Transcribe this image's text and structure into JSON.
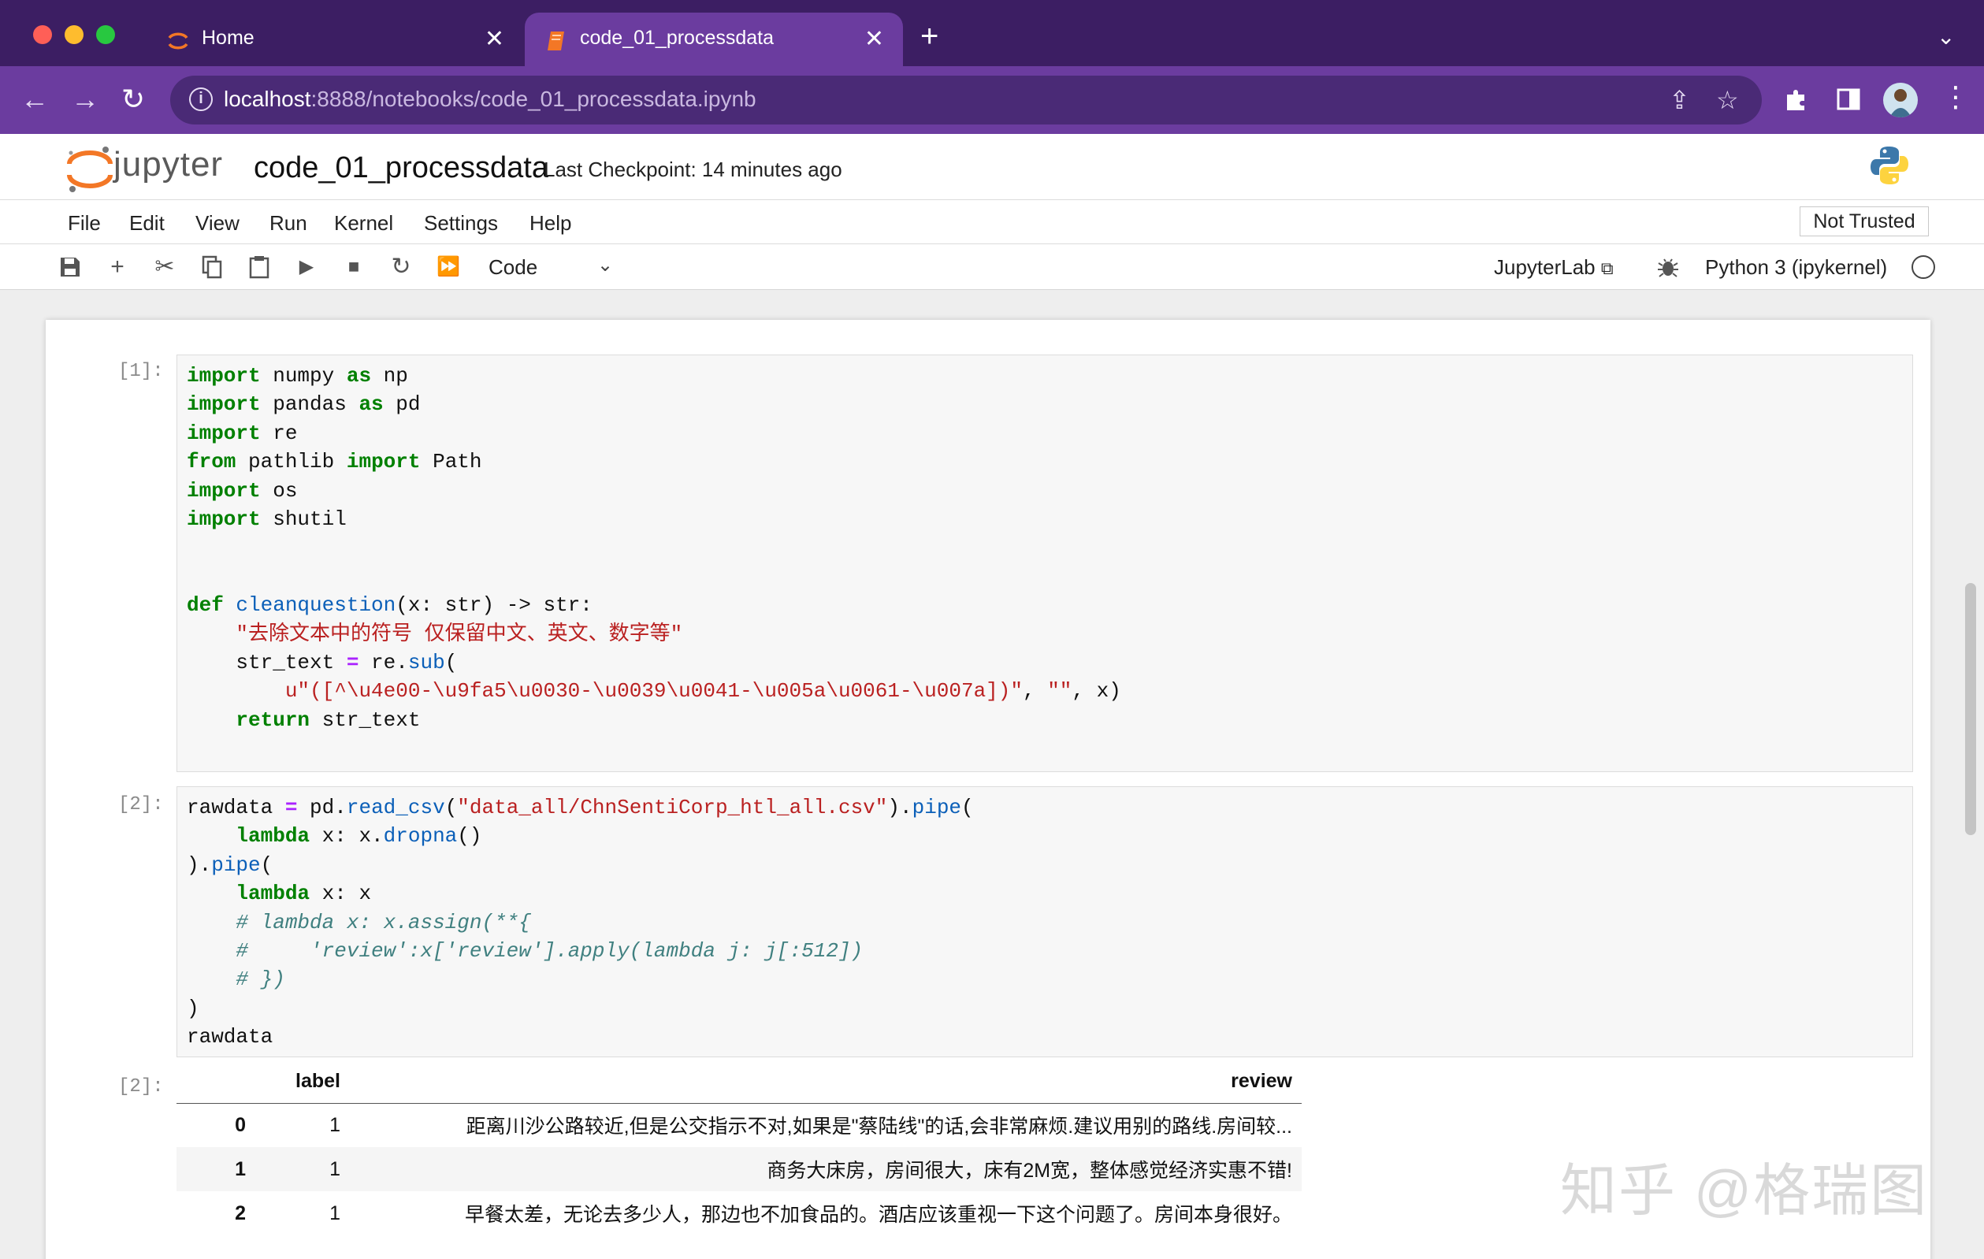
{
  "browser": {
    "tabs": [
      {
        "label": "Home",
        "active": false
      },
      {
        "label": "code_01_processdata",
        "active": true
      }
    ],
    "url_host": "localhost",
    "url_path": ":8888/notebooks/code_01_processdata.ipynb"
  },
  "jupyter": {
    "logo_text": "jupyter",
    "notebook_name": "code_01_processdata",
    "checkpoint": "Last Checkpoint: 14 minutes ago",
    "menu": [
      "File",
      "Edit",
      "View",
      "Run",
      "Kernel",
      "Settings",
      "Help"
    ],
    "trust_label": "Not Trusted",
    "cell_type": "Code",
    "jupyterlab_label": "JupyterLab",
    "kernel_label": "Python 3 (ipykernel)"
  },
  "cells": [
    {
      "prompt": "[1]:"
    },
    {
      "prompt": "[2]:"
    },
    {
      "prompt": "[2]:"
    }
  ],
  "output_table": {
    "columns": [
      "label",
      "review"
    ],
    "rows": [
      {
        "index": "0",
        "label": "1",
        "review": "距离川沙公路较近,但是公交指示不对,如果是\"蔡陆线\"的话,会非常麻烦.建议用别的路线.房间较..."
      },
      {
        "index": "1",
        "label": "1",
        "review": "商务大床房，房间很大，床有2M宽，整体感觉经济实惠不错!"
      },
      {
        "index": "2",
        "label": "1",
        "review": "早餐太差，无论去多少人，那边也不加食品的。酒店应该重视一下这个问题了。房间本身很好。"
      }
    ]
  },
  "watermark": "知乎 @格瑞图",
  "colors": {
    "tab_bar": "#3c1e63",
    "toolbar": "#6b3c9f",
    "keyword": "#008000",
    "string": "#ba2121",
    "comment": "#408080"
  }
}
